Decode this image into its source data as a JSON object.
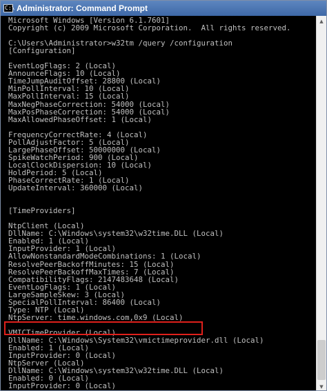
{
  "window": {
    "title": "Administrator: Command Prompt",
    "icon": "console-app-icon",
    "icon_glyph": "C:\\"
  },
  "console": {
    "lines": [
      "Microsoft Windows [Version 6.1.7601]",
      "Copyright (c) 2009 Microsoft Corporation.  All rights reserved.",
      "",
      "C:\\Users\\Administrator>w32tm /query /configuration",
      "[Configuration]",
      "",
      "EventLogFlags: 2 (Local)",
      "AnnounceFlags: 10 (Local)",
      "TimeJumpAuditOffset: 28800 (Local)",
      "MinPollInterval: 10 (Local)",
      "MaxPollInterval: 15 (Local)",
      "MaxNegPhaseCorrection: 54000 (Local)",
      "MaxPosPhaseCorrection: 54000 (Local)",
      "MaxAllowedPhaseOffset: 1 (Local)",
      "",
      "FrequencyCorrectRate: 4 (Local)",
      "PollAdjustFactor: 5 (Local)",
      "LargePhaseOffset: 50000000 (Local)",
      "SpikeWatchPeriod: 900 (Local)",
      "LocalClockDispersion: 10 (Local)",
      "HoldPeriod: 5 (Local)",
      "PhaseCorrectRate: 1 (Local)",
      "UpdateInterval: 360000 (Local)",
      "",
      "",
      "[TimeProviders]",
      "",
      "NtpClient (Local)",
      "DllName: C:\\Windows\\system32\\w32time.DLL (Local)",
      "Enabled: 1 (Local)",
      "InputProvider: 1 (Local)",
      "AllowNonstandardModeCombinations: 1 (Local)",
      "ResolvePeerBackoffMinutes: 15 (Local)",
      "ResolvePeerBackoffMaxTimes: 7 (Local)",
      "CompatibilityFlags: 2147483648 (Local)",
      "EventLogFlags: 1 (Local)",
      "LargeSampleSkew: 3 (Local)",
      "SpecialPollInterval: 86400 (Local)",
      "Type: NTP (Local)",
      "NtpServer: time.windows.com,0x9 (Local)",
      "",
      "VMICTimeProvider (Local)",
      "DllName: C:\\Windows\\System32\\vmictimeprovider.dll (Local)",
      "Enabled: 1 (Local)",
      "InputProvider: 0 (Local)",
      "NtpServer (Local)",
      "DllName: C:\\Windows\\system32\\w32time.DLL (Local)",
      "Enabled: 0 (Local)",
      "InputProvider: 0 (Local)"
    ]
  },
  "annotation": {
    "highlighted_line": "NtpServer: time.windows.com,0x9 (Local)",
    "highlight_color": "#e0201b"
  },
  "colors": {
    "console_background": "#000000",
    "console_text": "#c0c0c0",
    "titlebar": "#4a74b0",
    "title_text": "#ffffff"
  },
  "scrollbar": {
    "up_arrow": "▲",
    "down_arrow": "▼"
  }
}
